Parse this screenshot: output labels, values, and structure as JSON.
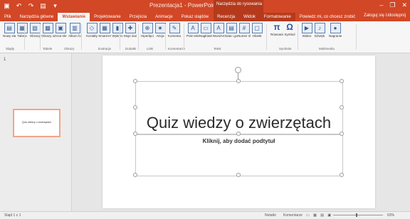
{
  "app": {
    "doc_title": "Prezentacja1 - PowerPoint",
    "context_tab_label": "Narzędzia do rysowania",
    "qat": [
      "▣",
      "↶",
      "↷",
      "▤",
      "▾"
    ],
    "win_controls": [
      "–",
      "❐",
      "✕"
    ]
  },
  "tabs": [
    {
      "label": "Plik"
    },
    {
      "label": "Narzędzia główne"
    },
    {
      "label": "Wstawianie",
      "active": true
    },
    {
      "label": "Projektowanie"
    },
    {
      "label": "Przejścia"
    },
    {
      "label": "Animacje"
    },
    {
      "label": "Pokaz slajdów"
    },
    {
      "label": "Recenzja"
    },
    {
      "label": "Widok"
    },
    {
      "label": "Formatowanie",
      "context": true
    },
    {
      "label": "Powiedz mi, co chcesz zrobić"
    }
  ],
  "tab_right": "Zaloguj się  Udostępnij",
  "ribbon": {
    "buttons": [
      {
        "icon": "▤",
        "label": "Nowy slajd"
      },
      {
        "icon": "▦",
        "label": "Tabela"
      },
      {
        "icon": "▨",
        "label": "Obrazy"
      },
      {
        "icon": "▩",
        "label": "Obrazy online"
      },
      {
        "icon": "▣",
        "label": "Zrzut ekranu"
      },
      {
        "icon": "▥",
        "label": "Album fotograficzny"
      },
      {
        "icon": "◇",
        "label": "Kształty"
      },
      {
        "icon": "▦",
        "label": "SmartArt"
      },
      {
        "icon": "▮",
        "label": "Wykres"
      },
      {
        "icon": "✚",
        "label": "Moje dodatki"
      },
      {
        "icon": "⊕",
        "label": "Hiperłącze"
      },
      {
        "icon": "★",
        "label": "Akcja"
      },
      {
        "icon": "✎",
        "label": "Komentarz"
      },
      {
        "icon": "A",
        "label": "Pole tekstowe"
      },
      {
        "icon": "▭",
        "label": "Nagłówek i stopka"
      },
      {
        "icon": "A",
        "label": "WordArt"
      },
      {
        "icon": "▤",
        "label": "Data i godzina"
      },
      {
        "icon": "#",
        "label": "Numer slajdu"
      },
      {
        "icon": "▢",
        "label": "Obiekt"
      },
      {
        "icon": "π",
        "label": "Równanie"
      },
      {
        "icon": "Ω",
        "label": "Symbol"
      },
      {
        "icon": "▶",
        "label": "Wideo"
      },
      {
        "icon": "♪",
        "label": "Dźwięk"
      },
      {
        "icon": "●",
        "label": "Nagranie ekranu"
      }
    ],
    "groups": [
      "Slajdy",
      "Tabele",
      "Obrazy",
      "Ilustracje",
      "Dodatki",
      "Linki",
      "Komentarze",
      "Tekst",
      "Symbole",
      "Multimedia"
    ]
  },
  "sidebar": {
    "slide_number": "1",
    "thumb_title": "Quiz wiedzy o zwierzętach"
  },
  "slide": {
    "title": "Quiz wiedzy o zwierzętach",
    "subtitle": "Kliknij, aby dodać podtytuł"
  },
  "status": {
    "slide_info": "Slajd 1 z 1",
    "notes": "Notatki",
    "comments": "Komentarze",
    "views": "▭ ▦ ▤ ▣",
    "zoom": "63%"
  }
}
